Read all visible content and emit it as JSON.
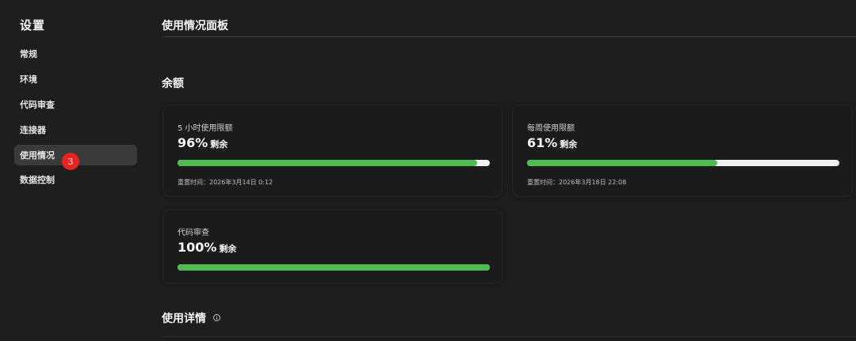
{
  "sidebar": {
    "title": "设置",
    "items": [
      {
        "label": "常规"
      },
      {
        "label": "环境"
      },
      {
        "label": "代码审查"
      },
      {
        "label": "连接器"
      },
      {
        "label": "使用情况"
      },
      {
        "label": "数据控制"
      }
    ],
    "active_index": 4,
    "badge": "3"
  },
  "main": {
    "title": "使用情况面板",
    "balance_heading": "余额",
    "details_heading": "使用详情",
    "cards": [
      {
        "label": "5 小时使用限额",
        "percent": "96%",
        "suffix": "剩余",
        "fill_fraction": 0.96,
        "reset": "重置时间：2026年3月14日 0:12"
      },
      {
        "label": "每周使用限额",
        "percent": "61%",
        "suffix": "剩余",
        "fill_fraction": 0.61,
        "reset": "重置时间：2026年3月18日 22:08"
      },
      {
        "label": "代码审查",
        "percent": "100%",
        "suffix": "剩余",
        "fill_fraction": 1.0
      }
    ]
  },
  "colors": {
    "background": "#1e1e1e",
    "progress_fill": "#4dbd52",
    "progress_track": "#f0f0f0",
    "badge": "#e8231f",
    "active_nav": "#3a3a3a"
  },
  "icons": {
    "details_info": "info-icon"
  }
}
